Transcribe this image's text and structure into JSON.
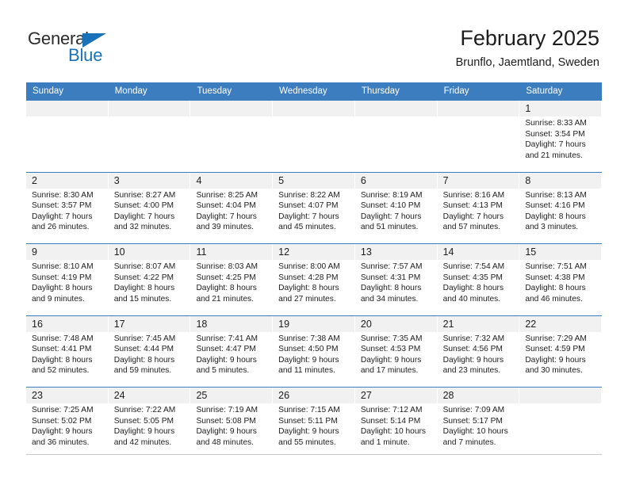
{
  "brand": {
    "name_part1": "General",
    "name_part2": "Blue",
    "triangle_icon": "triangle-icon",
    "accent_color": "#1a72b8"
  },
  "header": {
    "title": "February 2025",
    "location": "Brunflo, Jaemtland, Sweden"
  },
  "theme": {
    "header_blue": "#3b7dbf",
    "daynum_strip": "#f1f1f1",
    "text": "#1c1c1c"
  },
  "weekdays": [
    "Sunday",
    "Monday",
    "Tuesday",
    "Wednesday",
    "Thursday",
    "Friday",
    "Saturday"
  ],
  "weeks": [
    [
      {
        "day": "",
        "empty": true
      },
      {
        "day": "",
        "empty": true
      },
      {
        "day": "",
        "empty": true
      },
      {
        "day": "",
        "empty": true
      },
      {
        "day": "",
        "empty": true
      },
      {
        "day": "",
        "empty": true
      },
      {
        "day": "1",
        "sunrise": "Sunrise: 8:33 AM",
        "sunset": "Sunset: 3:54 PM",
        "daylight1": "Daylight: 7 hours",
        "daylight2": "and 21 minutes."
      }
    ],
    [
      {
        "day": "2",
        "sunrise": "Sunrise: 8:30 AM",
        "sunset": "Sunset: 3:57 PM",
        "daylight1": "Daylight: 7 hours",
        "daylight2": "and 26 minutes."
      },
      {
        "day": "3",
        "sunrise": "Sunrise: 8:27 AM",
        "sunset": "Sunset: 4:00 PM",
        "daylight1": "Daylight: 7 hours",
        "daylight2": "and 32 minutes."
      },
      {
        "day": "4",
        "sunrise": "Sunrise: 8:25 AM",
        "sunset": "Sunset: 4:04 PM",
        "daylight1": "Daylight: 7 hours",
        "daylight2": "and 39 minutes."
      },
      {
        "day": "5",
        "sunrise": "Sunrise: 8:22 AM",
        "sunset": "Sunset: 4:07 PM",
        "daylight1": "Daylight: 7 hours",
        "daylight2": "and 45 minutes."
      },
      {
        "day": "6",
        "sunrise": "Sunrise: 8:19 AM",
        "sunset": "Sunset: 4:10 PM",
        "daylight1": "Daylight: 7 hours",
        "daylight2": "and 51 minutes."
      },
      {
        "day": "7",
        "sunrise": "Sunrise: 8:16 AM",
        "sunset": "Sunset: 4:13 PM",
        "daylight1": "Daylight: 7 hours",
        "daylight2": "and 57 minutes."
      },
      {
        "day": "8",
        "sunrise": "Sunrise: 8:13 AM",
        "sunset": "Sunset: 4:16 PM",
        "daylight1": "Daylight: 8 hours",
        "daylight2": "and 3 minutes."
      }
    ],
    [
      {
        "day": "9",
        "sunrise": "Sunrise: 8:10 AM",
        "sunset": "Sunset: 4:19 PM",
        "daylight1": "Daylight: 8 hours",
        "daylight2": "and 9 minutes."
      },
      {
        "day": "10",
        "sunrise": "Sunrise: 8:07 AM",
        "sunset": "Sunset: 4:22 PM",
        "daylight1": "Daylight: 8 hours",
        "daylight2": "and 15 minutes."
      },
      {
        "day": "11",
        "sunrise": "Sunrise: 8:03 AM",
        "sunset": "Sunset: 4:25 PM",
        "daylight1": "Daylight: 8 hours",
        "daylight2": "and 21 minutes."
      },
      {
        "day": "12",
        "sunrise": "Sunrise: 8:00 AM",
        "sunset": "Sunset: 4:28 PM",
        "daylight1": "Daylight: 8 hours",
        "daylight2": "and 27 minutes."
      },
      {
        "day": "13",
        "sunrise": "Sunrise: 7:57 AM",
        "sunset": "Sunset: 4:31 PM",
        "daylight1": "Daylight: 8 hours",
        "daylight2": "and 34 minutes."
      },
      {
        "day": "14",
        "sunrise": "Sunrise: 7:54 AM",
        "sunset": "Sunset: 4:35 PM",
        "daylight1": "Daylight: 8 hours",
        "daylight2": "and 40 minutes."
      },
      {
        "day": "15",
        "sunrise": "Sunrise: 7:51 AM",
        "sunset": "Sunset: 4:38 PM",
        "daylight1": "Daylight: 8 hours",
        "daylight2": "and 46 minutes."
      }
    ],
    [
      {
        "day": "16",
        "sunrise": "Sunrise: 7:48 AM",
        "sunset": "Sunset: 4:41 PM",
        "daylight1": "Daylight: 8 hours",
        "daylight2": "and 52 minutes."
      },
      {
        "day": "17",
        "sunrise": "Sunrise: 7:45 AM",
        "sunset": "Sunset: 4:44 PM",
        "daylight1": "Daylight: 8 hours",
        "daylight2": "and 59 minutes."
      },
      {
        "day": "18",
        "sunrise": "Sunrise: 7:41 AM",
        "sunset": "Sunset: 4:47 PM",
        "daylight1": "Daylight: 9 hours",
        "daylight2": "and 5 minutes."
      },
      {
        "day": "19",
        "sunrise": "Sunrise: 7:38 AM",
        "sunset": "Sunset: 4:50 PM",
        "daylight1": "Daylight: 9 hours",
        "daylight2": "and 11 minutes."
      },
      {
        "day": "20",
        "sunrise": "Sunrise: 7:35 AM",
        "sunset": "Sunset: 4:53 PM",
        "daylight1": "Daylight: 9 hours",
        "daylight2": "and 17 minutes."
      },
      {
        "day": "21",
        "sunrise": "Sunrise: 7:32 AM",
        "sunset": "Sunset: 4:56 PM",
        "daylight1": "Daylight: 9 hours",
        "daylight2": "and 23 minutes."
      },
      {
        "day": "22",
        "sunrise": "Sunrise: 7:29 AM",
        "sunset": "Sunset: 4:59 PM",
        "daylight1": "Daylight: 9 hours",
        "daylight2": "and 30 minutes."
      }
    ],
    [
      {
        "day": "23",
        "sunrise": "Sunrise: 7:25 AM",
        "sunset": "Sunset: 5:02 PM",
        "daylight1": "Daylight: 9 hours",
        "daylight2": "and 36 minutes."
      },
      {
        "day": "24",
        "sunrise": "Sunrise: 7:22 AM",
        "sunset": "Sunset: 5:05 PM",
        "daylight1": "Daylight: 9 hours",
        "daylight2": "and 42 minutes."
      },
      {
        "day": "25",
        "sunrise": "Sunrise: 7:19 AM",
        "sunset": "Sunset: 5:08 PM",
        "daylight1": "Daylight: 9 hours",
        "daylight2": "and 48 minutes."
      },
      {
        "day": "26",
        "sunrise": "Sunrise: 7:15 AM",
        "sunset": "Sunset: 5:11 PM",
        "daylight1": "Daylight: 9 hours",
        "daylight2": "and 55 minutes."
      },
      {
        "day": "27",
        "sunrise": "Sunrise: 7:12 AM",
        "sunset": "Sunset: 5:14 PM",
        "daylight1": "Daylight: 10 hours",
        "daylight2": "and 1 minute."
      },
      {
        "day": "28",
        "sunrise": "Sunrise: 7:09 AM",
        "sunset": "Sunset: 5:17 PM",
        "daylight1": "Daylight: 10 hours",
        "daylight2": "and 7 minutes."
      },
      {
        "day": "",
        "empty": true
      }
    ]
  ]
}
